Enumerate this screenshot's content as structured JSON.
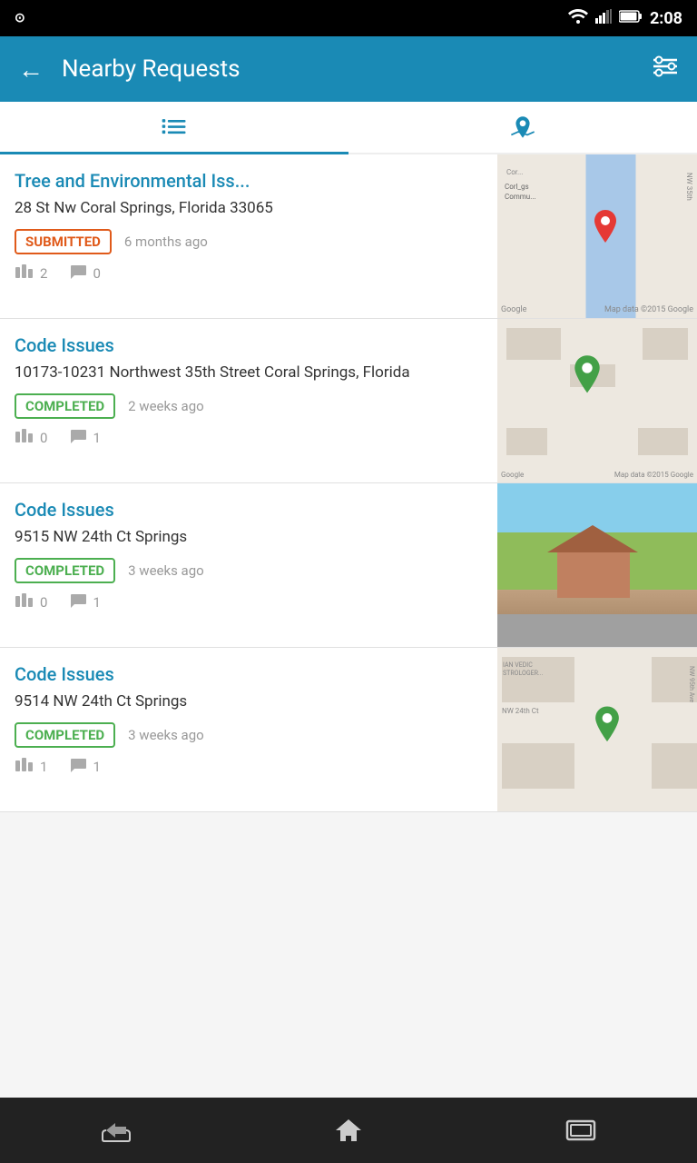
{
  "status_bar": {
    "time": "2:08",
    "location_icon": "⊙"
  },
  "header": {
    "back_label": "←",
    "title": "Nearby Requests",
    "filter_label": "⊟"
  },
  "tabs": [
    {
      "id": "list",
      "label": "List",
      "active": true
    },
    {
      "id": "map",
      "label": "Map",
      "active": false
    }
  ],
  "items": [
    {
      "id": "item1",
      "title": "Tree and Environmental Iss...",
      "address": "28  St Nw Coral Springs, Florida 33065",
      "badge": "SUBMITTED",
      "badge_type": "submitted",
      "time_ago": "6 months ago",
      "votes": "2",
      "comments": "0"
    },
    {
      "id": "item2",
      "title": "Code Issues",
      "address": "10173-10231  Northwest 35th Street Coral Springs, Florida",
      "badge": "COMPLETED",
      "badge_type": "completed",
      "time_ago": "2 weeks ago",
      "votes": "0",
      "comments": "1"
    },
    {
      "id": "item3",
      "title": "Code Issues",
      "address": "9515  NW 24th Ct  Springs",
      "badge": "COMPLETED",
      "badge_type": "completed",
      "time_ago": "3 weeks ago",
      "votes": "0",
      "comments": "1"
    },
    {
      "id": "item4",
      "title": "Code Issues",
      "address": "9514  NW 24th Ct  Springs",
      "badge": "COMPLETED",
      "badge_type": "completed",
      "time_ago": "3 weeks ago",
      "votes": "1",
      "comments": "1"
    }
  ],
  "map_labels": {
    "google": "Google",
    "map_data": "Map data ©2015 Google"
  },
  "nav": {
    "back": "⟵",
    "home": "⌂",
    "recents": "▭"
  }
}
